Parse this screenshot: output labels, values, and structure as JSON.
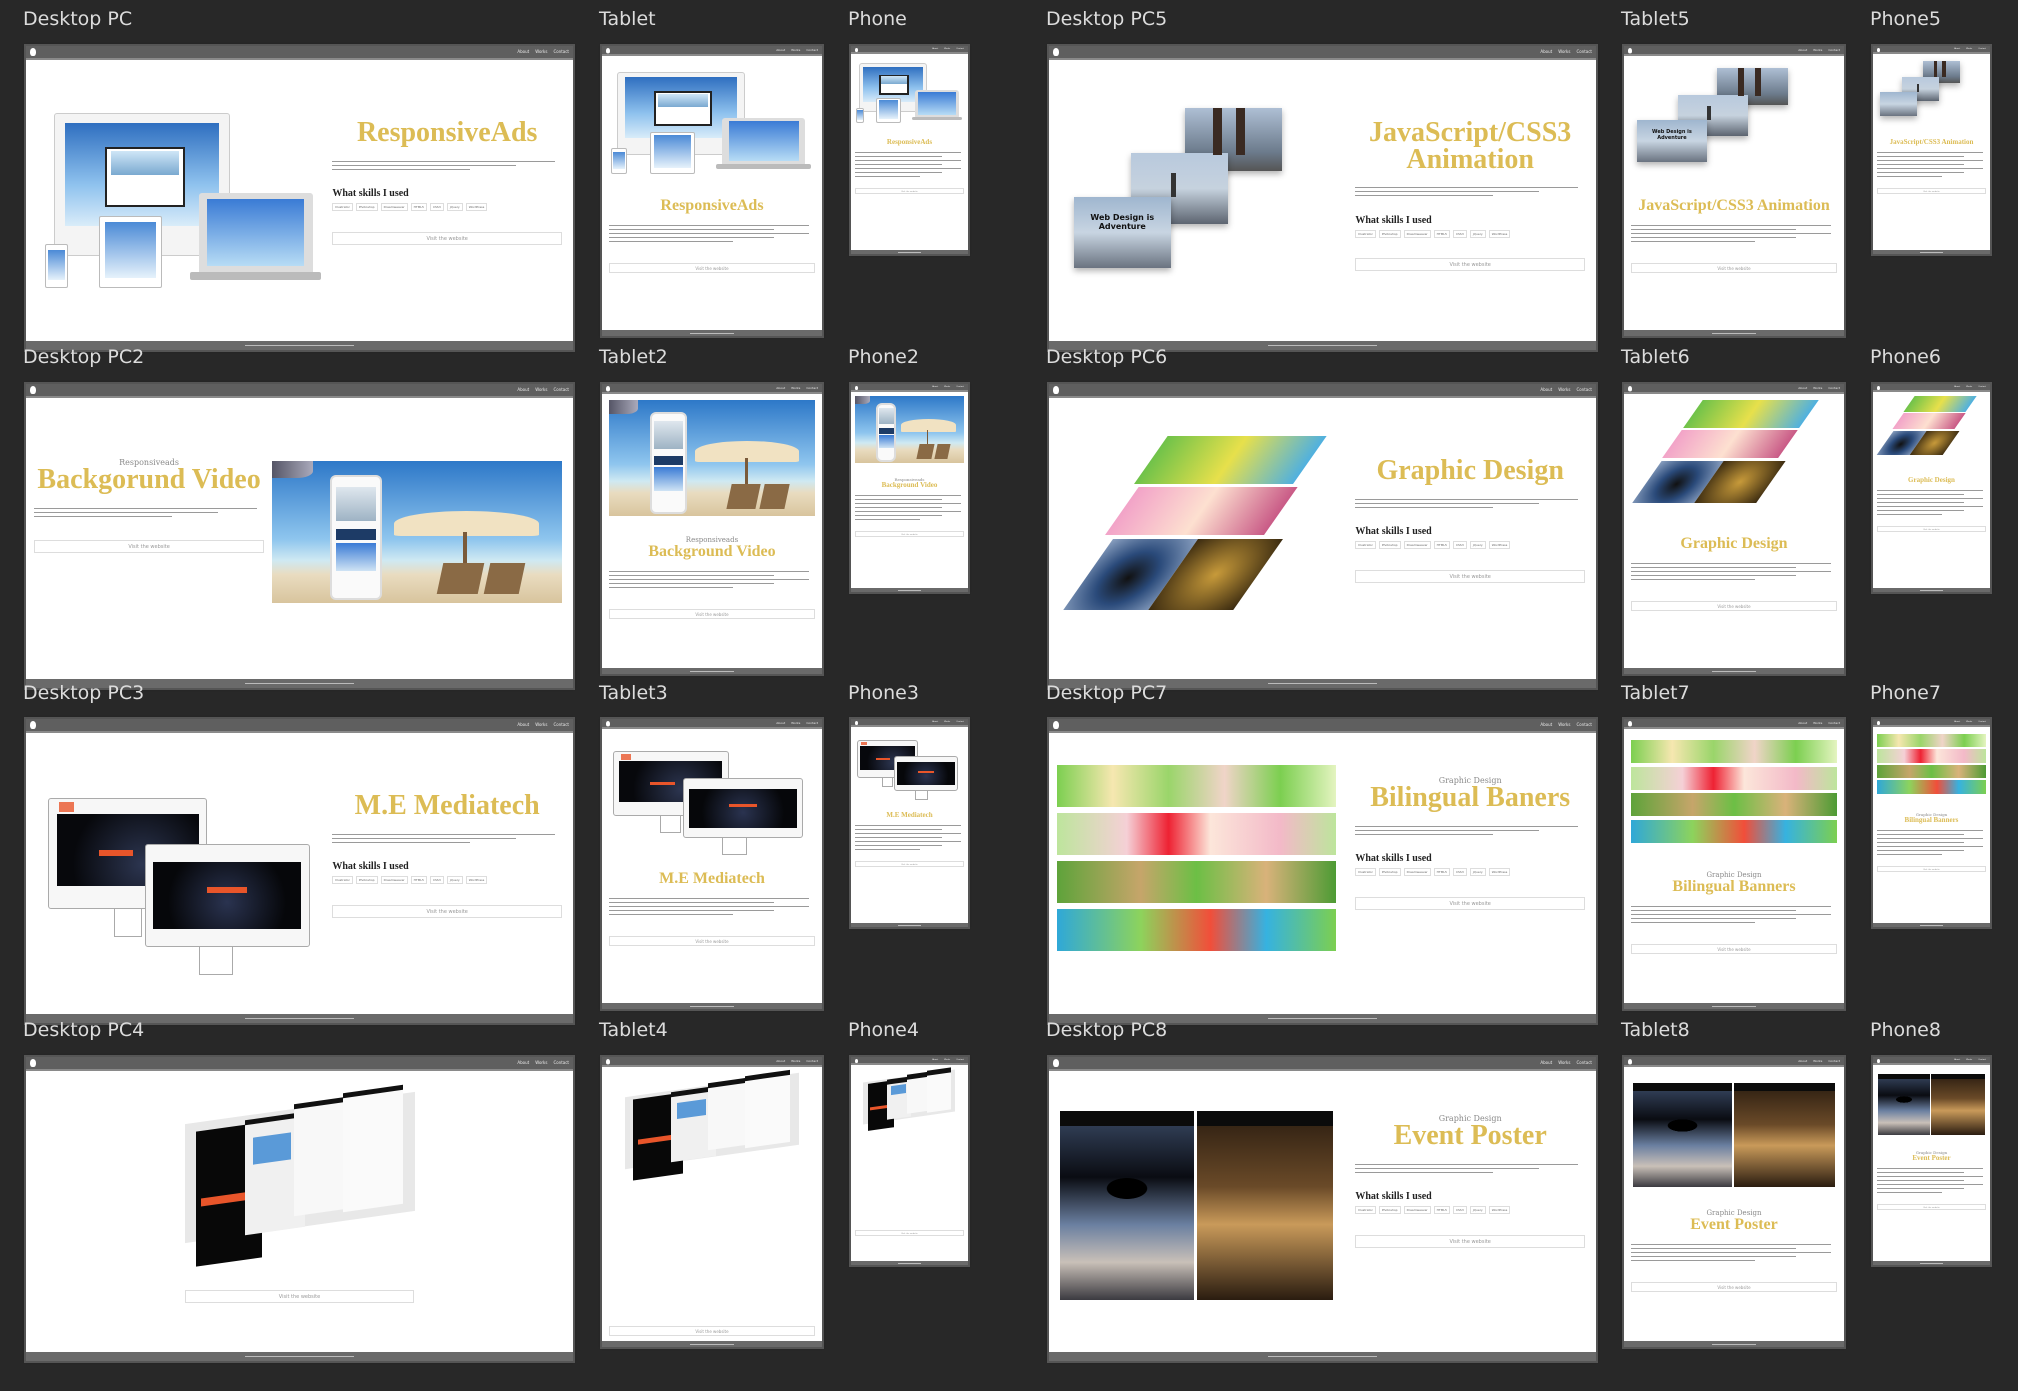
{
  "nav": {
    "items": [
      "About",
      "Works",
      "Contact"
    ]
  },
  "common": {
    "skills_heading": "What skills I used",
    "skills": [
      "Illustrator",
      "Photoshop",
      "Dreamweaver",
      "HTML5",
      "CSS3",
      "jQuery",
      "WordPress"
    ],
    "visit_button": "Visit the website"
  },
  "colors": {
    "canvas": "#282828",
    "title_gold": "#dcbc55",
    "navbar": "#5f5f5f"
  },
  "sets": [
    {
      "rows": [
        {
          "desktop": {
            "label": "Desktop PC",
            "layout": "image-left",
            "theme": "devices",
            "eyebrow": "",
            "title": "ResponsiveAds",
            "skills": true
          },
          "tablet": {
            "label": "Tablet",
            "theme": "devices",
            "eyebrow": "",
            "title": "ResponsiveAds"
          },
          "phone": {
            "label": "Phone",
            "theme": "devices",
            "eyebrow": "",
            "title": "ResponsiveAds"
          }
        },
        {
          "desktop": {
            "label": "Desktop PC2",
            "layout": "text-left",
            "theme": "beach",
            "eyebrow": "Responsiveads",
            "title": "Backgorund Video",
            "skills": false
          },
          "tablet": {
            "label": "Tablet2",
            "theme": "beach",
            "eyebrow": "Responsiveads",
            "title": "Background Video"
          },
          "phone": {
            "label": "Phone2",
            "theme": "beach",
            "eyebrow": "Responsiveads",
            "title": "Background Video"
          }
        },
        {
          "desktop": {
            "label": "Desktop PC3",
            "layout": "image-left",
            "theme": "mediatech",
            "eyebrow": "",
            "title": "M.E Mediatech",
            "skills": true
          },
          "tablet": {
            "label": "Tablet3",
            "theme": "mediatech",
            "eyebrow": "",
            "title": "M.E Mediatech"
          },
          "phone": {
            "label": "Phone3",
            "theme": "mediatech",
            "eyebrow": "",
            "title": "M.E Mediatech"
          }
        },
        {
          "desktop": {
            "label": "Desktop PC4",
            "layout": "center",
            "theme": "phones",
            "eyebrow": "",
            "title": "",
            "skills": false
          },
          "tablet": {
            "label": "Tablet4",
            "theme": "phones",
            "eyebrow": "",
            "title": ""
          },
          "phone": {
            "label": "Phone4",
            "theme": "phones",
            "eyebrow": "",
            "title": ""
          }
        }
      ]
    },
    {
      "rows": [
        {
          "desktop": {
            "label": "Desktop PC5",
            "layout": "image-left",
            "theme": "mountain",
            "eyebrow": "",
            "title": "JavaScript/CSS3 Animation",
            "skills": true,
            "image_caption": "Web Design is Adventure"
          },
          "tablet": {
            "label": "Tablet5",
            "theme": "mountain",
            "eyebrow": "",
            "title": "JavaScript/CSS3 Animation",
            "image_caption": "Web Design is Adventure"
          },
          "phone": {
            "label": "Phone5",
            "theme": "mountain",
            "eyebrow": "",
            "title": "JavaScript/CSS3 Animation"
          }
        },
        {
          "desktop": {
            "label": "Desktop PC6",
            "layout": "image-left",
            "theme": "graphic",
            "eyebrow": "",
            "title": "Graphic Design",
            "skills": true
          },
          "tablet": {
            "label": "Tablet6",
            "theme": "graphic",
            "eyebrow": "",
            "title": "Graphic Design"
          },
          "phone": {
            "label": "Phone6",
            "theme": "graphic",
            "eyebrow": "",
            "title": "Graphic Design"
          }
        },
        {
          "desktop": {
            "label": "Desktop PC7",
            "layout": "image-left",
            "theme": "banners",
            "eyebrow": "Graphic Design",
            "title": "Bilingual Baners",
            "skills": true
          },
          "tablet": {
            "label": "Tablet7",
            "theme": "banners",
            "eyebrow": "Graphic Design",
            "title": "Bilingual Banners"
          },
          "phone": {
            "label": "Phone7",
            "theme": "banners",
            "eyebrow": "Graphic Design",
            "title": "Bilingual Banners"
          }
        },
        {
          "desktop": {
            "label": "Desktop PC8",
            "layout": "image-left",
            "theme": "posters",
            "eyebrow": "Graphic Design",
            "title": "Event Poster",
            "skills": true
          },
          "tablet": {
            "label": "Tablet8",
            "theme": "posters",
            "eyebrow": "Graphic Design",
            "title": "Event Poster"
          },
          "phone": {
            "label": "Phone8",
            "theme": "posters",
            "eyebrow": "Graphic Design",
            "title": "Event Poster"
          }
        }
      ]
    }
  ]
}
